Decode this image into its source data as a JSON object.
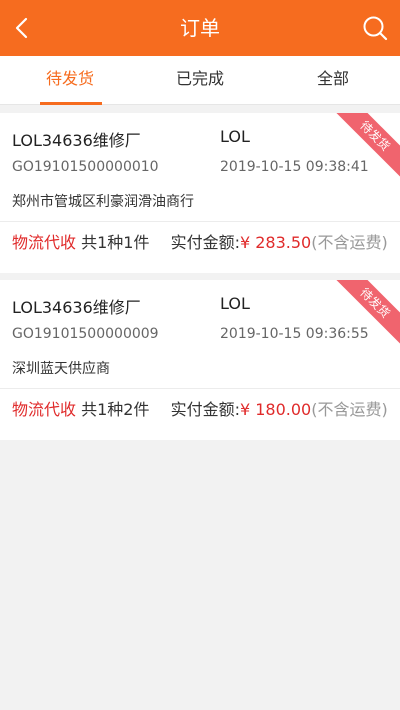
{
  "header": {
    "title": "订单",
    "back_icon": "chevron-left-icon",
    "search_icon": "search-icon"
  },
  "tabs": [
    {
      "label": "待发货",
      "active": true
    },
    {
      "label": "已完成",
      "active": false
    },
    {
      "label": "全部",
      "active": false
    }
  ],
  "colors": {
    "brand": "#f66c1f",
    "price": "#e02b2b",
    "ribbon": "#f0646e"
  },
  "orders": [
    {
      "shop": "LOL34636维修厂",
      "buyer": "LOL",
      "order_no": "GO19101500000010",
      "time": "2019-10-15 09:38:41",
      "supplier": "郑州市管城区利豪润滑油商行",
      "logistics": "物流代收",
      "summary": "共1种1件",
      "paid_label": "实付金额:",
      "price": "¥ 283.50",
      "note": "(不含运费)",
      "status": "待发货"
    },
    {
      "shop": "LOL34636维修厂",
      "buyer": "LOL",
      "order_no": "GO19101500000009",
      "time": "2019-10-15 09:36:55",
      "supplier": "深圳蓝天供应商",
      "logistics": "物流代收",
      "summary": "共1种2件",
      "paid_label": "实付金额:",
      "price": "¥ 180.00",
      "note": "(不含运费)",
      "status": "待发货"
    }
  ]
}
